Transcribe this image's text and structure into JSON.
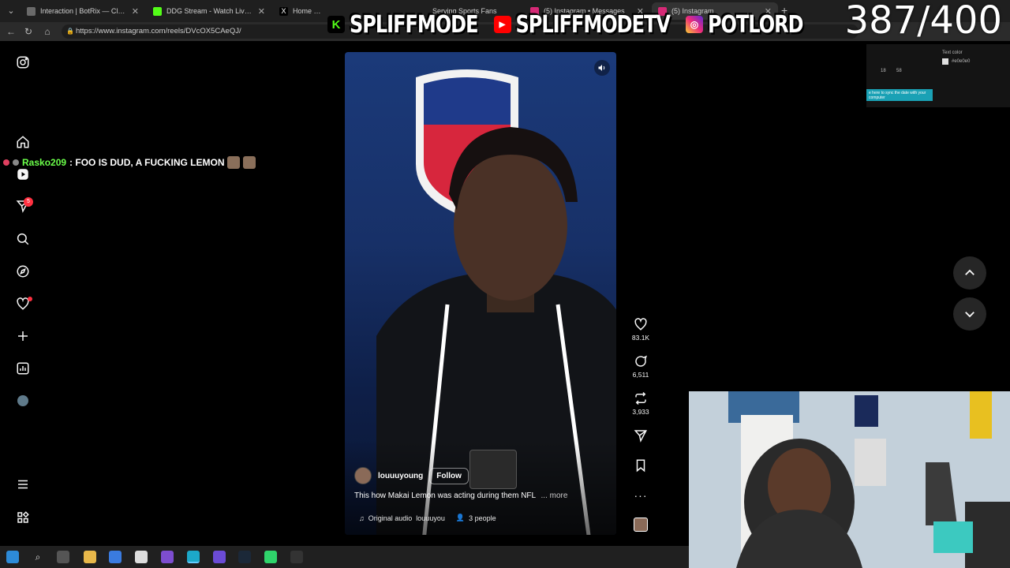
{
  "browser": {
    "tabs": [
      {
        "label": "Interaction | BotRix — Cloud",
        "active": false
      },
      {
        "label": "DDG Stream - Watch Live on Kick",
        "active": false
      },
      {
        "label": "Home / X",
        "active": false
      },
      {
        "label": "Serving Sports Fans",
        "active": false
      },
      {
        "label": "(5) Instagram • Messages",
        "active": false
      },
      {
        "label": "(5) Instagram",
        "active": true
      }
    ],
    "url": "https://www.instagram.com/reels/DVcOX5CAeQJ/"
  },
  "overlay": {
    "handles": [
      "SPLIFFMODE",
      "SPLIFFMODETV",
      "POTLORD"
    ],
    "counter": "387/400"
  },
  "sidebar": {
    "items": [
      {
        "icon": "instagram-logo-icon"
      },
      {
        "icon": "home-icon"
      },
      {
        "icon": "reels-icon"
      },
      {
        "icon": "messages-icon",
        "badge": "5"
      },
      {
        "icon": "search-icon"
      },
      {
        "icon": "explore-icon"
      },
      {
        "icon": "notifications-icon"
      },
      {
        "icon": "create-icon"
      },
      {
        "icon": "dashboard-icon"
      },
      {
        "icon": "profile-icon"
      },
      {
        "icon": "menu-icon"
      },
      {
        "icon": "also-from-meta-icon"
      }
    ]
  },
  "chat": {
    "username": "Rasko209",
    "message": ": FOO IS DUD, A FUCKING LEMON"
  },
  "reel": {
    "author": "louuuyoung",
    "follow_label": "Follow",
    "caption": "This how Makai Lemon was acting during them NFL",
    "more_label": "... more",
    "audio": "Original audio",
    "audio_author": "louuuyou",
    "people": "3 people"
  },
  "actions": {
    "likes": "83.1K",
    "comments": "6,511",
    "reposts": "3,933"
  },
  "clock_widget": {
    "text_color_label": "Text color",
    "hex": "#e0e0e0",
    "hour": "18",
    "minute": "58",
    "sync_label": "e here to sync the date with your computer"
  },
  "colors": {
    "ig_bg": "#000000",
    "badge": "#ff3040",
    "chat_user": "#6bff4a"
  }
}
